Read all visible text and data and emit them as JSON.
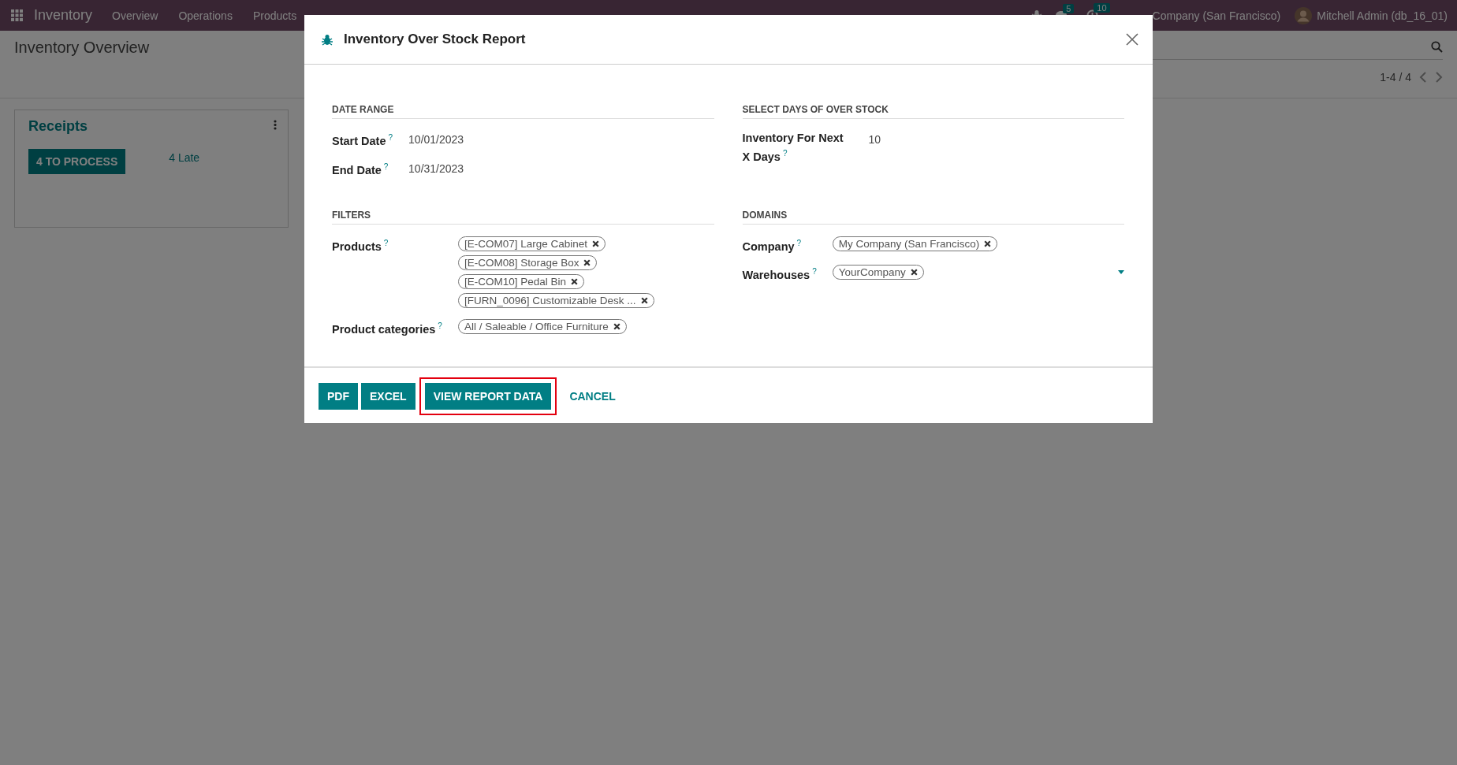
{
  "navbar": {
    "app": "Inventory",
    "menu": [
      "Overview",
      "Operations",
      "Products"
    ],
    "badges": [
      {
        "kind": "chat",
        "count": "5"
      },
      {
        "kind": "activity",
        "count": "10"
      }
    ],
    "company": "Company (San Francisco)",
    "user": "Mitchell Admin (db_16_01)"
  },
  "control_panel": {
    "title": "Inventory Overview",
    "pager": "1-4 / 4"
  },
  "cards": [
    {
      "title": "Receipts",
      "button": "4 TO PROCESS",
      "late": "4 Late"
    }
  ],
  "dialog": {
    "title": "Inventory Over Stock Report",
    "sections": [
      {
        "heading": "DATE RANGE",
        "fields": [
          {
            "kind": "text",
            "label": "Start Date",
            "help": "?",
            "value": "10/01/2023"
          },
          {
            "kind": "text",
            "label": "End Date",
            "help": "?",
            "value": "10/31/2023"
          }
        ]
      },
      {
        "heading": "SELECT DAYS OF OVER STOCK",
        "fields": [
          {
            "kind": "text",
            "label": "Inventory For Next X Days",
            "help": "?",
            "value": "10"
          }
        ]
      },
      {
        "heading": "FILTERS",
        "fields": [
          {
            "kind": "tags",
            "label": "Products",
            "help": "?",
            "dropdown": false,
            "tags": [
              "[E-COM07] Large Cabinet",
              "[E-COM08] Storage Box",
              "[E-COM10] Pedal Bin",
              "[FURN_0096] Customizable Desk ..."
            ]
          },
          {
            "kind": "tags",
            "label": "Product categories",
            "help": "?",
            "dropdown": false,
            "tags": [
              "All / Saleable / Office Furniture"
            ]
          }
        ]
      },
      {
        "heading": "DOMAINS",
        "fields": [
          {
            "kind": "tags",
            "label": "Company",
            "help": "?",
            "dropdown": false,
            "tags": [
              "My Company (San Francisco)"
            ]
          },
          {
            "kind": "tags",
            "label": "Warehouses",
            "help": "?",
            "dropdown": true,
            "tags": [
              "YourCompany"
            ]
          }
        ]
      }
    ],
    "buttons": [
      {
        "kind": "primary",
        "label": "PDF",
        "highlighted": false
      },
      {
        "kind": "primary",
        "label": "EXCEL",
        "highlighted": false
      },
      {
        "kind": "primary",
        "label": "VIEW REPORT DATA",
        "highlighted": true
      },
      {
        "kind": "link",
        "label": "CANCEL",
        "highlighted": false
      }
    ]
  }
}
